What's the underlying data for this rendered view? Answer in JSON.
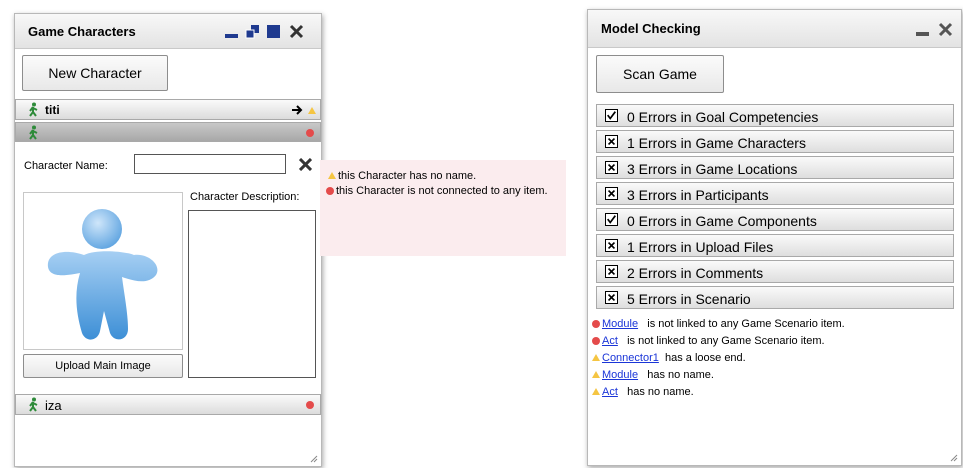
{
  "characters_panel": {
    "title": "Game Characters",
    "new_character_label": "New Character",
    "characters": [
      {
        "name": "titi"
      },
      {
        "name": ""
      },
      {
        "name": "iza"
      }
    ],
    "form": {
      "name_label": "Character Name:",
      "name_value": "",
      "description_label": "Character Description:",
      "description_value": "",
      "upload_label": "Upload Main Image"
    }
  },
  "tooltip": {
    "warning": "this Character  has no name.",
    "error": "this Character  is not connected to any item."
  },
  "model_panel": {
    "title": "Model Checking",
    "scan_label": "Scan Game",
    "categories": [
      {
        "label": "0 Errors in Goal Competencies",
        "state": "checked"
      },
      {
        "label": "1 Errors in Game Characters",
        "state": "error"
      },
      {
        "label": "3 Errors in Game Locations",
        "state": "error"
      },
      {
        "label": "3 Errors in Participants",
        "state": "error"
      },
      {
        "label": "0 Errors in Game Components",
        "state": "checked"
      },
      {
        "label": "1 Errors in Upload Files",
        "state": "error"
      },
      {
        "label": "2 Errors in Comments",
        "state": "error"
      },
      {
        "label": "5 Errors in Scenario",
        "state": "error"
      }
    ],
    "messages": [
      {
        "type": "error",
        "link": "Module",
        "text": "is not linked to any Game Scenario item."
      },
      {
        "type": "error",
        "link": "Act",
        "text": "is not linked to any Game Scenario item."
      },
      {
        "type": "warning",
        "link": "Connector1",
        "text": "has a loose end."
      },
      {
        "type": "warning",
        "link": "Module",
        "text": "has no name."
      },
      {
        "type": "warning",
        "link": "Act",
        "text": "has no name."
      }
    ]
  },
  "colors": {
    "error": "#e44b4b",
    "warning": "#f5c542",
    "tooltip_bg": "#fbecee",
    "link": "#1a35d8"
  }
}
